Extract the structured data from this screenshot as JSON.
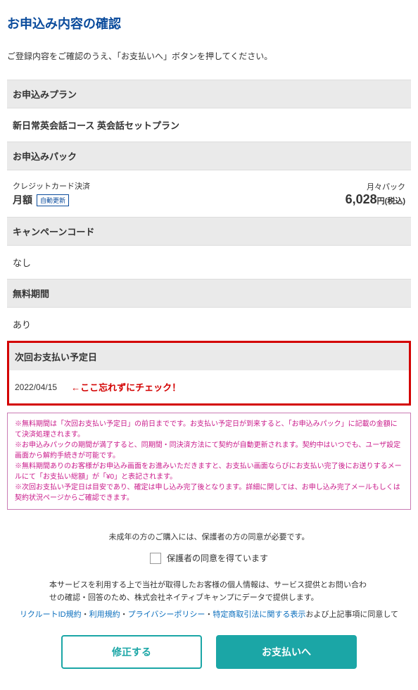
{
  "page_title": "お申込み内容の確認",
  "instruction": "ご登録内容をご確認のうえ、「お支払いへ」ボタンを押してください。",
  "plan": {
    "header": "お申込みプラン",
    "name": "新日常英会話コース 英会話セットプラン"
  },
  "pack": {
    "header": "お申込みパック",
    "payment_method": "クレジットカード決済",
    "monthly_label": "月額",
    "auto_renew": "自動更新",
    "pack_type": "月々パック",
    "price": "6,028",
    "price_suffix": "円(税込)"
  },
  "campaign": {
    "header": "キャンペーンコード",
    "value": "なし"
  },
  "free_period": {
    "header": "無料期間",
    "value": "あり"
  },
  "next_payment": {
    "header": "次回お支払い予定日",
    "date": "2022/04/15",
    "red_note": "←ここ忘れずにチェック！"
  },
  "notices": [
    "※無料期間は「次回お支払い予定日」の前日までです。お支払い予定日が到来すると、「お申込みパック」に記載の金額にて決済処理されます。",
    "※お申込みパックの期間が満了すると、同期間・同決済方法にて契約が自動更新されます。契約中はいつでも、ユーザ設定画面から解約手続きが可能です。",
    "※無料期間ありのお客様がお申込み画面をお進みいただきますと、お支払い画面ならびにお支払い完了後にお送りするメールにて「お支払い総額」が「¥0」と表記されます。",
    "※次回お支払い予定日は目安であり、確定は申し込み完了後となります。詳細に関しては、お申し込み完了メールもしくは契約状況ページからご確認できます。"
  ],
  "consent": {
    "title": "未成年の方のご購入には、保護者の方の同意が必要です。",
    "checkbox_label": "保護者の同意を得ています"
  },
  "disclaimer": "本サービスを利用する上で当社が取得したお客様の個人情報は、サービス提供とお問い合わせの確認・回答のため、株式会社ネイティブキャンプにデータで提供します。",
  "links": {
    "recruit_id": "リクルートID規約",
    "terms": "利用規約",
    "privacy": "プライバシーポリシー",
    "commerce": "特定商取引法に関する表示",
    "sep": "・",
    "suffix": "および上記事項に同意して"
  },
  "buttons": {
    "edit": "修正する",
    "pay": "お支払いへ"
  }
}
